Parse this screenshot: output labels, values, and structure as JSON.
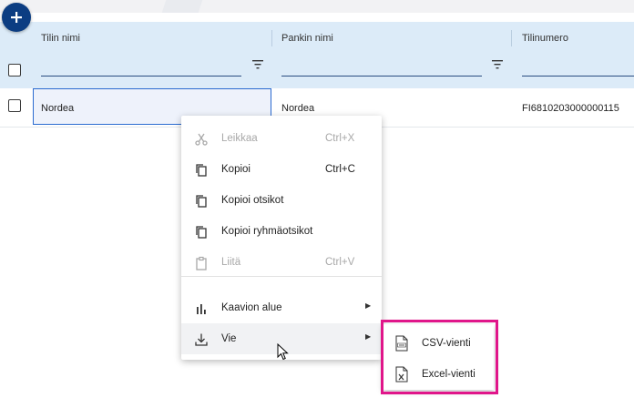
{
  "toolbar": {
    "add_button_label": "+"
  },
  "grid": {
    "columns": [
      {
        "title": "Tilin nimi"
      },
      {
        "title": "Pankin nimi"
      },
      {
        "title": "Tilinumero"
      }
    ],
    "rows": [
      {
        "account_name": "Nordea",
        "bank_name": "Nordea",
        "account_number": "FI6810203000000115"
      }
    ]
  },
  "context_menu": {
    "items": [
      {
        "label": "Leikkaa",
        "shortcut": "Ctrl+X",
        "icon": "scissors-icon",
        "disabled": true
      },
      {
        "label": "Kopioi",
        "shortcut": "Ctrl+C",
        "icon": "copy-icon",
        "disabled": false
      },
      {
        "label": "Kopioi otsikot",
        "shortcut": "",
        "icon": "copy-icon",
        "disabled": false
      },
      {
        "label": "Kopioi ryhmäotsikot",
        "shortcut": "",
        "icon": "copy-icon",
        "disabled": false
      },
      {
        "label": "Liitä",
        "shortcut": "Ctrl+V",
        "icon": "clipboard-icon",
        "disabled": true
      },
      {
        "label": "Kaavion alue",
        "shortcut": "",
        "icon": "bar-chart-icon",
        "has_submenu": true
      },
      {
        "label": "Vie",
        "shortcut": "",
        "icon": "download-icon",
        "has_submenu": true
      }
    ]
  },
  "export_submenu": {
    "items": [
      {
        "label": "CSV-vienti",
        "icon": "csv-file-icon"
      },
      {
        "label": "Excel-vienti",
        "icon": "excel-file-icon"
      }
    ]
  },
  "colors": {
    "header_bg": "#dcebf8",
    "fab_bg": "#0c3d82",
    "highlight_border": "#e0168a",
    "focus_border": "#2b6bd0"
  }
}
